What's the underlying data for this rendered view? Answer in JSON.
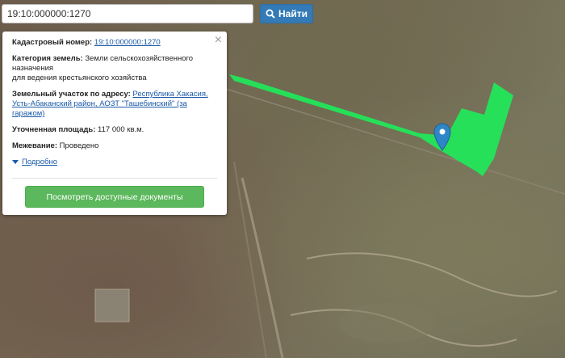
{
  "search": {
    "value": "19:10:000000:1270",
    "button_label": "Найти"
  },
  "popup": {
    "cadastral_label": "Кадастровый номер:",
    "cadastral_value": "19:10:000000:1270",
    "category_label": "Категория земель:",
    "category_value": "Земли сельскохозяйственного назначения",
    "category_value2": "для ведения крестьянского хозяйства",
    "address_label": "Земельный участок по адресу:",
    "address_value": "Республика Хакасия, Усть-Абаканский район, АОЗТ \"Ташебинский\" (за гаражом)",
    "area_label": "Уточненная площадь:",
    "area_value": "117 000 кв.м.",
    "survey_label": "Межевание:",
    "survey_value": "Проведено",
    "details_label": "Подробно",
    "docs_button": "Посмотреть доступные документы",
    "close": "×"
  },
  "colors": {
    "parcel": "#22e65a",
    "marker": "#2f86c6",
    "search_button": "#337ab7",
    "docs_button": "#5cb85c"
  }
}
